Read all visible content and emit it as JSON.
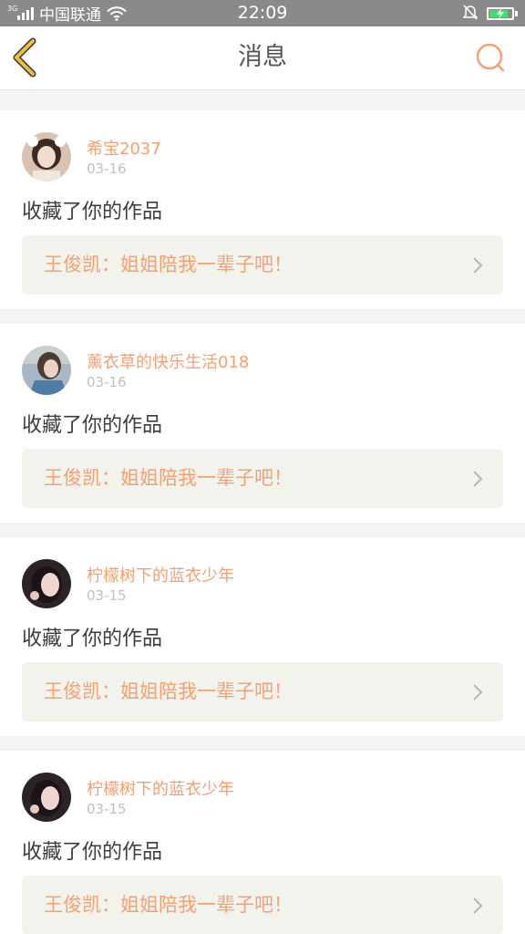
{
  "status_bar": {
    "network_type": "3G",
    "carrier": "中国联通",
    "time": "22:09",
    "battery_percent": 0.85,
    "battery_color": "#3ee06a",
    "icons": [
      "signal-icon",
      "wifi-icon",
      "silent-bell-icon",
      "battery-charging-icon"
    ]
  },
  "nav": {
    "title": "消息",
    "back_icon": "chevron-left-icon",
    "search_icon": "search-icon",
    "accent_color": "#f5a070",
    "back_color": "#e9c13c"
  },
  "messages": [
    {
      "username": "希宝2037",
      "date": "03-16",
      "action": "收藏了你的作品",
      "work": "王俊凯：姐姐陪我一辈子吧！",
      "avatar_colors": [
        "#d9c3b0",
        "#3a2a22",
        "#f1dccd"
      ]
    },
    {
      "username": "薰衣草的快乐生活018",
      "date": "03-16",
      "action": "收藏了你的作品",
      "work": "王俊凯：姐姐陪我一辈子吧！",
      "avatar_colors": [
        "#a9b7c4",
        "#4a3b33",
        "#4f7ca6"
      ]
    },
    {
      "username": "柠檬树下的蓝衣少年",
      "date": "03-15",
      "action": "收藏了你的作品",
      "work": "王俊凯：姐姐陪我一辈子吧！",
      "avatar_colors": [
        "#2b2326",
        "#1c1416",
        "#f0d6cf"
      ]
    },
    {
      "username": "柠檬树下的蓝衣少年",
      "date": "03-15",
      "action": "收藏了你的作品",
      "work": "王俊凯：姐姐陪我一辈子吧！",
      "avatar_colors": [
        "#2b2326",
        "#1c1416",
        "#f0d6cf"
      ]
    }
  ]
}
